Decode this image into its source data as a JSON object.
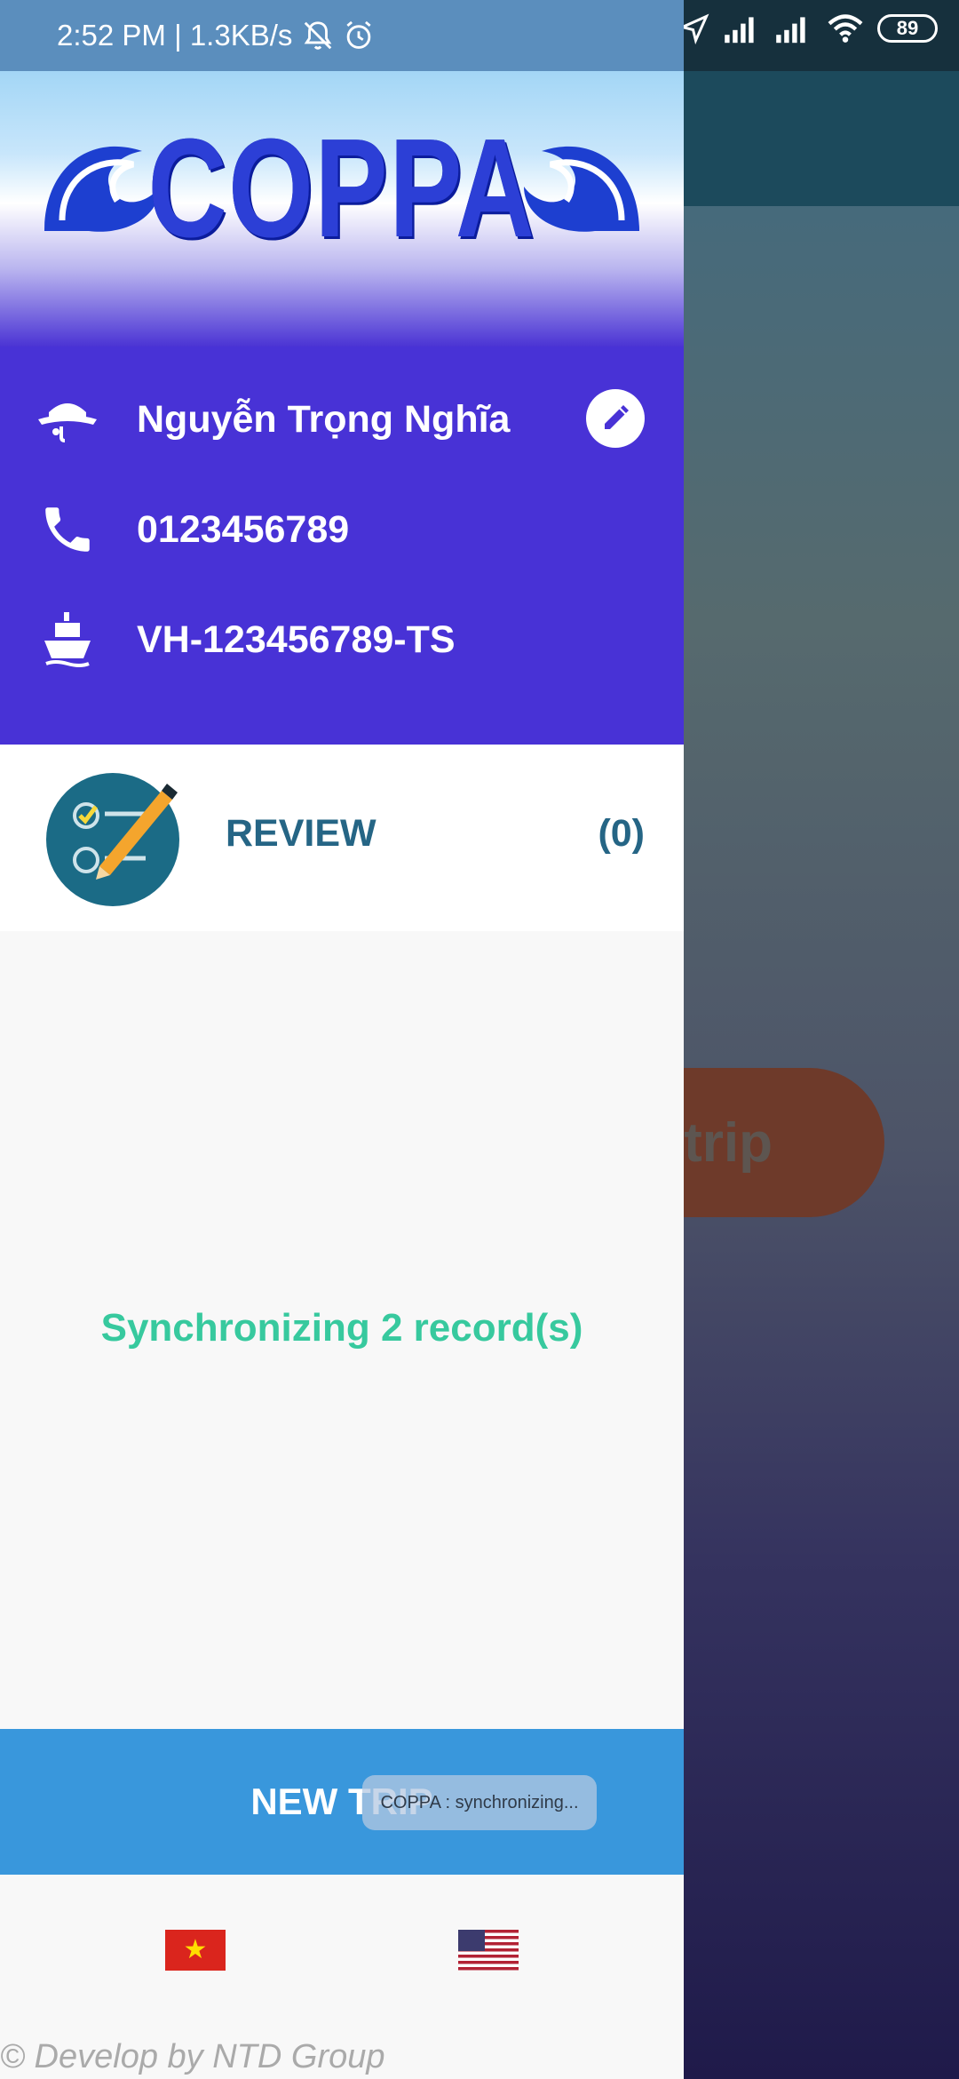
{
  "status_bar": {
    "time": "2:52 PM",
    "speed": "1.3KB/s",
    "battery": "89"
  },
  "background_app": {
    "trip_button_partial": "trip"
  },
  "header": {
    "logo": "COPPA"
  },
  "profile": {
    "name": "Nguyễn Trọng Nghĩa",
    "phone": "0123456789",
    "boat_id": "VH-123456789-TS"
  },
  "review": {
    "label": "REVIEW",
    "count": "(0)"
  },
  "sync": {
    "message": "Synchronizing 2 record(s)"
  },
  "new_trip": {
    "label": "NEW TRIP"
  },
  "toast": {
    "message": "COPPA : synchronizing..."
  },
  "languages": [
    "vi",
    "en"
  ],
  "footer": {
    "credit": "© Develop by NTD Group"
  },
  "colors": {
    "drawer_header": "#4832d6",
    "review_text": "#256585",
    "sync_text": "#37c99e",
    "new_trip_button": "#3997dc"
  }
}
